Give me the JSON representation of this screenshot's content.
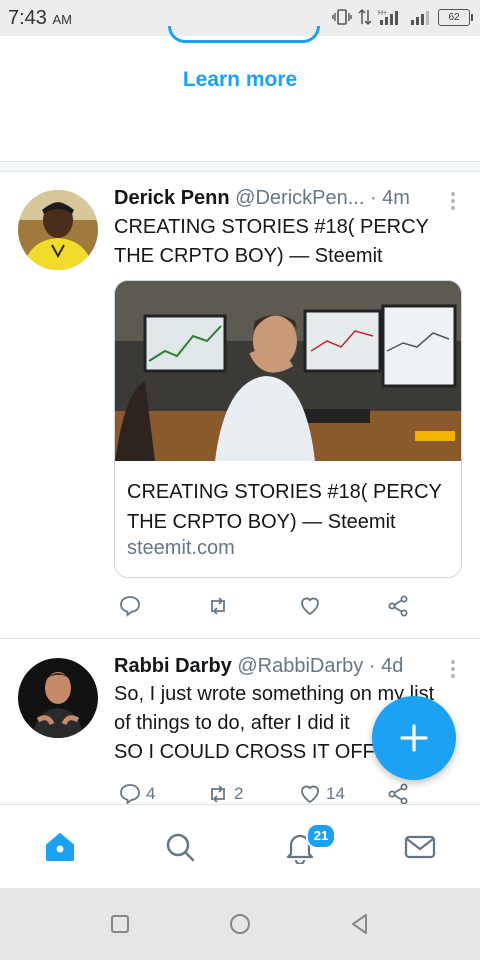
{
  "status_bar": {
    "time": "7:43",
    "ampm": "AM",
    "battery": "62"
  },
  "promo": {
    "learn_more": "Learn more"
  },
  "tweets": [
    {
      "name": "Derick Penn",
      "handle": "@DerickPen...",
      "time": "· 4m",
      "text_line1": "CREATING STORIES #18( PERCY",
      "text_line2": "THE CRPTO BOY) — Steemit",
      "card": {
        "title_line1": "CREATING STORIES #18( PERCY",
        "title_line2": "THE CRPTO BOY) — Steemit",
        "domain": "steemit.com"
      },
      "reply_count": "",
      "retweet_count": "",
      "like_count": ""
    },
    {
      "name": "Rabbi Darby",
      "handle": "@RabbiDarby",
      "time": "· 4d",
      "text_line1": "So, I just wrote something on my list",
      "text_line2": "of things to do, after I did it",
      "text_line3": "SO I COULD CROSS IT OFF!",
      "reply_count": "4",
      "retweet_count": "2",
      "like_count": "14"
    }
  ],
  "bottom_nav": {
    "notifications_badge": "21"
  },
  "colors": {
    "accent": "#1da1f2",
    "secondary_text": "#657786",
    "divider": "#dfe4e8"
  },
  "icons": [
    "home-icon",
    "search-icon",
    "bell-icon",
    "mail-icon",
    "reply-icon",
    "retweet-icon",
    "heart-icon",
    "share-icon",
    "compose-plus-icon",
    "more-vert-icon"
  ]
}
